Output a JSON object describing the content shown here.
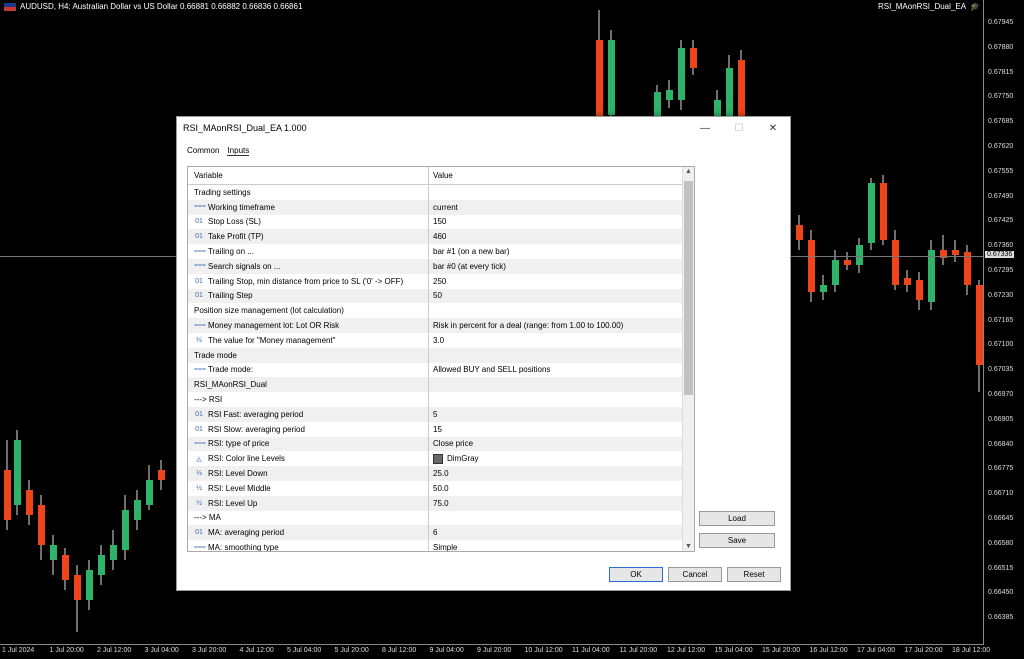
{
  "chart": {
    "symbol_line": "AUDUSD, H4:  Australian Dollar vs US Dollar  0.66881 0.66882 0.66836 0.66861",
    "ea_name": "RSI_MAonRSI_Dual_EA",
    "current_price": "0.67336",
    "price_ticks": [
      "0.67945",
      "0.67880",
      "0.67815",
      "0.67750",
      "0.67685",
      "0.67620",
      "0.67555",
      "0.67490",
      "0.67425",
      "0.67360",
      "0.67295",
      "0.67230",
      "0.67165",
      "0.67100",
      "0.67035",
      "0.66970",
      "0.66905",
      "0.66840",
      "0.66775",
      "0.66710",
      "0.66645",
      "0.66580",
      "0.66515",
      "0.66450",
      "0.66385"
    ],
    "time_ticks": [
      "1 Jul 2024",
      "1 Jul 20:00",
      "2 Jul 12:00",
      "3 Jul 04:00",
      "3 Jul 20:00",
      "4 Jul 12:00",
      "5 Jul 04:00",
      "5 Jul 20:00",
      "8 Jul 12:00",
      "9 Jul 04:00",
      "9 Jul 20:00",
      "10 Jul 12:00",
      "11 Jul 04:00",
      "11 Jul 20:00",
      "12 Jul 12:00",
      "15 Jul 04:00",
      "15 Jul 20:00",
      "16 Jul 12:00",
      "17 Jul 04:00",
      "17 Jul 20:00",
      "18 Jul 12:00"
    ],
    "colors": {
      "bull": "#2fb36a",
      "bear": "#f0441a",
      "background": "#000000"
    }
  },
  "dialog": {
    "title": "RSI_MAonRSI_Dual_EA 1.000",
    "tabs": [
      "Common",
      "Inputs"
    ],
    "header": {
      "variable": "Variable",
      "value": "Value"
    },
    "rows": [
      {
        "icon": "",
        "variable": "Trading settings",
        "value": ""
      },
      {
        "icon": "list-icon",
        "variable": "Working timeframe",
        "value": "current"
      },
      {
        "icon": "int-icon",
        "variable": "Stop Loss (SL)",
        "value": "150"
      },
      {
        "icon": "int-icon",
        "variable": "Take Profit (TP)",
        "value": "460"
      },
      {
        "icon": "list-icon",
        "variable": "Trailing on ...",
        "value": "bar #1 (on a new bar)"
      },
      {
        "icon": "list-icon",
        "variable": "Search signals on ...",
        "value": "bar #0 (at every tick)"
      },
      {
        "icon": "int-icon",
        "variable": "Trailing Stop, min distance from price to SL ('0' -> OFF)",
        "value": "250"
      },
      {
        "icon": "int-icon",
        "variable": "Trailing Step",
        "value": "50"
      },
      {
        "icon": "",
        "variable": "Position size management (lot calculation)",
        "value": ""
      },
      {
        "icon": "list-icon",
        "variable": "Money management lot: Lot OR Risk",
        "value": "Risk in percent for a deal (range: from 1.00 to 100.00)"
      },
      {
        "icon": "double-icon",
        "variable": "The value for \"Money management\"",
        "value": "3.0"
      },
      {
        "icon": "",
        "variable": "Trade mode",
        "value": ""
      },
      {
        "icon": "list-icon",
        "variable": "Trade mode:",
        "value": "Allowed BUY and SELL positions"
      },
      {
        "icon": "",
        "variable": "RSI_MAonRSI_Dual",
        "value": ""
      },
      {
        "icon": "",
        "variable": "---> RSI",
        "value": ""
      },
      {
        "icon": "int-icon",
        "variable": "RSI Fast: averaging period",
        "value": "5"
      },
      {
        "icon": "int-icon",
        "variable": "RSI Slow: averaging period",
        "value": "15"
      },
      {
        "icon": "list-icon",
        "variable": "RSI: type of price",
        "value": "Close price"
      },
      {
        "icon": "color-icon",
        "variable": "RSI: Color line Levels",
        "value": "DimGray"
      },
      {
        "icon": "double-icon",
        "variable": "RSI: Level Down",
        "value": "25.0"
      },
      {
        "icon": "double-icon",
        "variable": "RSI: Level Middle",
        "value": "50.0"
      },
      {
        "icon": "double-icon",
        "variable": "RSI: Level Up",
        "value": "75.0"
      },
      {
        "icon": "",
        "variable": "---> MA",
        "value": ""
      },
      {
        "icon": "int-icon",
        "variable": "MA: averaging period",
        "value": "6"
      },
      {
        "icon": "list-icon",
        "variable": "MA: smoothing type",
        "value": "Simple"
      }
    ],
    "buttons": {
      "load": "Load",
      "save": "Save",
      "ok": "OK",
      "cancel": "Cancel",
      "reset": "Reset"
    },
    "window_controls": {
      "minimize": "—",
      "maximize": "☐",
      "close": "✕"
    }
  }
}
